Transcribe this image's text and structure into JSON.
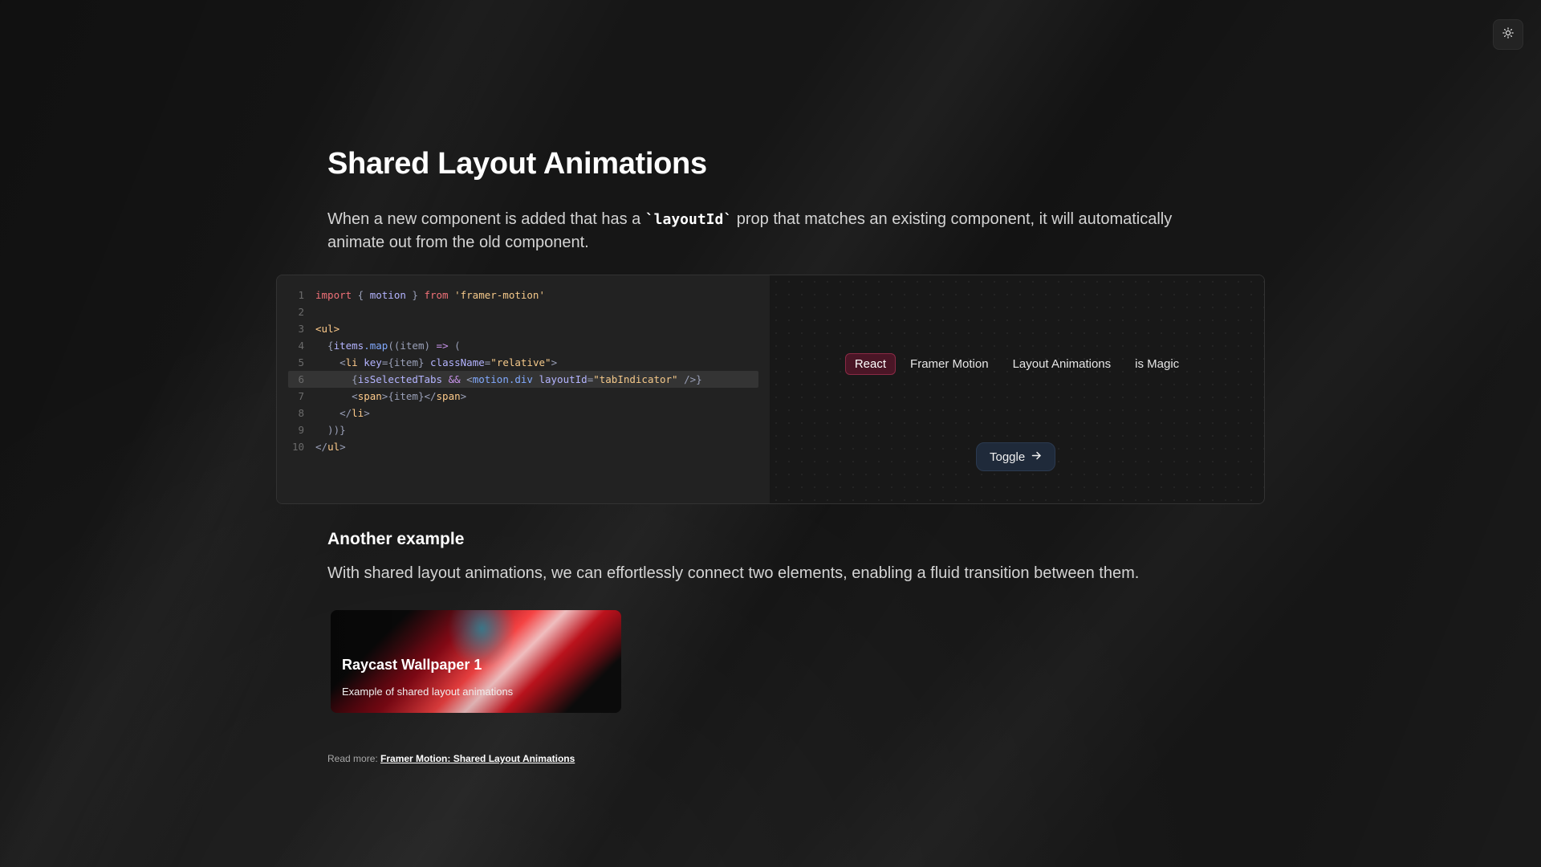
{
  "header": {
    "theme_toggle_icon": "sun-icon"
  },
  "main": {
    "title": "Shared Layout Animations",
    "intro_before": "When a new component is added that has a ",
    "intro_code": "`layoutId`",
    "intro_after": " prop that matches an existing component, it will automatically animate out from the old component."
  },
  "demo": {
    "code_lines": [
      {
        "n": "1",
        "highlighted": false
      },
      {
        "n": "2",
        "highlighted": false
      },
      {
        "n": "3",
        "highlighted": false
      },
      {
        "n": "4",
        "highlighted": false
      },
      {
        "n": "5",
        "highlighted": false
      },
      {
        "n": "6",
        "highlighted": true
      },
      {
        "n": "7",
        "highlighted": false
      },
      {
        "n": "8",
        "highlighted": false
      },
      {
        "n": "9",
        "highlighted": false
      },
      {
        "n": "10",
        "highlighted": false
      }
    ],
    "code": {
      "l1_import": "import",
      "l1_open": " { ",
      "l1_motion": "motion",
      "l1_close": " } ",
      "l1_from": "from",
      "l1_str": " 'framer-motion'",
      "l3": "<ul>",
      "l4_open": "  {",
      "l4_items": "items",
      "l4_map": ".map",
      "l4_args": "((item) ",
      "l4_arrow": "=>",
      "l4_paren": " (",
      "l5_open": "    <",
      "l5_li": "li",
      "l5_key": " key",
      "l5_keyval": "={item}",
      "l5_class": " className",
      "l5_eq": "=",
      "l5_str": "\"relative\"",
      "l5_close": ">",
      "l6_open": "      {",
      "l6_sel": "isSelectedTabs",
      "l6_and": " && ",
      "l6_tag": "<",
      "l6_md": "motion.div",
      "l6_attr": " layoutId",
      "l6_eq": "=",
      "l6_str": "\"tabIndicator\"",
      "l6_end": " />}",
      "l7_open": "      <",
      "l7_span": "span",
      "l7_mid": ">{item}</",
      "l7_span2": "span",
      "l7_close": ">",
      "l8_open": "    </",
      "l8_li": "li",
      "l8_close": ">",
      "l9": "  ))}",
      "l10_open": "</",
      "l10_ul": "ul",
      "l10_close": ">"
    },
    "tabs": [
      {
        "label": "React",
        "active": true
      },
      {
        "label": "Framer Motion",
        "active": false
      },
      {
        "label": "Layout Animations",
        "active": false
      },
      {
        "label": "is Magic",
        "active": false
      }
    ],
    "toggle_label": "Toggle",
    "toggle_icon": "arrow-right-icon"
  },
  "another": {
    "heading": "Another example",
    "text": "With shared layout animations, we can effortlessly connect two elements, enabling a fluid transition between them."
  },
  "card": {
    "title": "Raycast Wallpaper 1",
    "description": "Example of shared layout animations"
  },
  "footer": {
    "read_more_label": "Read more: ",
    "read_more_link": "Framer Motion: Shared Layout Animations"
  }
}
